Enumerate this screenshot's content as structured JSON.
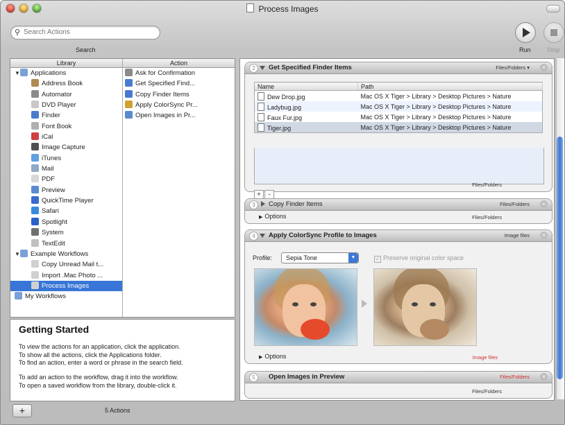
{
  "window": {
    "title": "Process Images"
  },
  "toolbar": {
    "search_placeholder": "Search Actions",
    "search_label": "Search",
    "run_label": "Run",
    "stop_label": "Stop"
  },
  "library": {
    "header": "Library",
    "items": [
      {
        "label": "Applications",
        "indent": 0,
        "disclosure": "open",
        "icon": "folder-icon",
        "color": "#7aa0d8"
      },
      {
        "label": "Address Book",
        "indent": 1,
        "icon": "address-book-icon",
        "color": "#b08a50"
      },
      {
        "label": "Automator",
        "indent": 1,
        "icon": "automator-icon",
        "color": "#8a8a8a"
      },
      {
        "label": "DVD Player",
        "indent": 1,
        "icon": "dvd-player-icon",
        "color": "#c8c8c8"
      },
      {
        "label": "Finder",
        "indent": 1,
        "icon": "finder-icon",
        "color": "#4a7ad0"
      },
      {
        "label": "Font Book",
        "indent": 1,
        "icon": "font-book-icon",
        "color": "#b0b0b0"
      },
      {
        "label": "iCal",
        "indent": 1,
        "icon": "ical-icon",
        "color": "#d04040"
      },
      {
        "label": "Image Capture",
        "indent": 1,
        "icon": "camera-icon",
        "color": "#505050"
      },
      {
        "label": "iTunes",
        "indent": 1,
        "icon": "itunes-icon",
        "color": "#60a0e0"
      },
      {
        "label": "Mail",
        "indent": 1,
        "icon": "mail-icon",
        "color": "#8fa8c8"
      },
      {
        "label": "PDF",
        "indent": 1,
        "icon": "pdf-icon",
        "color": "#d8d8d8"
      },
      {
        "label": "Preview",
        "indent": 1,
        "icon": "preview-icon",
        "color": "#5a8ad0"
      },
      {
        "label": "QuickTime Player",
        "indent": 1,
        "icon": "quicktime-icon",
        "color": "#3a6ad0"
      },
      {
        "label": "Safari",
        "indent": 1,
        "icon": "safari-icon",
        "color": "#3a8ae0"
      },
      {
        "label": "Spotlight",
        "indent": 1,
        "icon": "spotlight-icon",
        "color": "#2a60c8"
      },
      {
        "label": "System",
        "indent": 1,
        "icon": "system-icon",
        "color": "#707070"
      },
      {
        "label": "TextEdit",
        "indent": 1,
        "icon": "textedit-icon",
        "color": "#c0c0c0"
      },
      {
        "label": "Example Workflows",
        "indent": 0,
        "disclosure": "open",
        "icon": "folder-icon",
        "color": "#7aa0d8"
      },
      {
        "label": "Copy Unread Mail t...",
        "indent": 1,
        "icon": "workflow-icon",
        "color": "#d0d0d0"
      },
      {
        "label": "Import .Mac Photo ...",
        "indent": 1,
        "icon": "workflow-icon",
        "color": "#d0d0d0"
      },
      {
        "label": "Process Images",
        "indent": 1,
        "icon": "workflow-icon",
        "color": "#d0d0d0",
        "selected": true
      },
      {
        "label": "My Workflows",
        "indent": 0,
        "icon": "folder-icon",
        "color": "#7aa0d8"
      }
    ]
  },
  "actions": {
    "header": "Action",
    "items": [
      {
        "label": "Ask for Confirmation",
        "icon": "automator-icon",
        "color": "#8a8a8a"
      },
      {
        "label": "Get Specified Find...",
        "icon": "finder-icon",
        "color": "#4a7ad0"
      },
      {
        "label": "Copy Finder Items",
        "icon": "finder-icon",
        "color": "#4a7ad0"
      },
      {
        "label": "Apply ColorSync Pr...",
        "icon": "colorsync-icon",
        "color": "#d0a030"
      },
      {
        "label": "Open Images in Pr...",
        "icon": "preview-icon",
        "color": "#5a8ad0"
      }
    ]
  },
  "info": {
    "title": "Getting Started",
    "para1": [
      "To view the actions for an application, click the application.",
      "To show all the actions, click the Applications folder.",
      "To find an action, enter a word or phrase in the search field."
    ],
    "para2": [
      "To add an action to the workflow, drag it into the workflow.",
      "To open a saved workflow from the library, double-click it."
    ]
  },
  "workflow": {
    "step1": {
      "number": "2",
      "title": "Get Specified Finder Items",
      "type": "Files/Folders ▾",
      "columns": [
        "Name",
        "Path"
      ],
      "rows": [
        {
          "name": "Dew Drop.jpg",
          "path": "Mac OS X Tiger > Library > Desktop Pictures > Nature"
        },
        {
          "name": "Ladybug.jpg",
          "path": "Mac OS X Tiger > Library > Desktop Pictures > Nature"
        },
        {
          "name": "Faux Fur.jpg",
          "path": "Mac OS X Tiger > Library > Desktop Pictures > Nature"
        },
        {
          "name": "Tiger.jpg",
          "path": "Mac OS X Tiger > Library > Desktop Pictures > Nature"
        }
      ],
      "add": "+",
      "remove": "-",
      "output": "Files/Folders"
    },
    "step2": {
      "number": "3",
      "title": "Copy Finder Items",
      "type": "Files/Folders",
      "options": "Options",
      "output": "Files/Folders"
    },
    "step3": {
      "number": "4",
      "title": "Apply ColorSync Profile to Images",
      "type": "Image files",
      "profile_label": "Profile:",
      "profile_value": "Sepia Tone",
      "preserve_label": "Preserve original color space",
      "options": "Options",
      "output": "Image files",
      "output_color": "#d03030"
    },
    "step4": {
      "number": "5",
      "title": "Open Images in Preview",
      "type": "Files/Folders",
      "type_color": "#d03030",
      "output": "Files/Folders"
    }
  },
  "statusbar": {
    "add": "+",
    "count": "5 Actions"
  }
}
